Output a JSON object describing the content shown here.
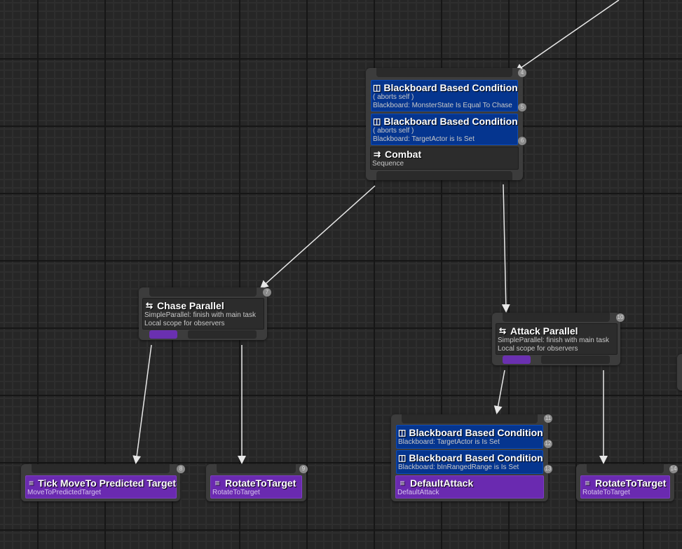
{
  "nodes": {
    "combat": {
      "badge": "4",
      "decorators": [
        {
          "title": "Blackboard Based Condition",
          "abort": "( aborts self )",
          "detail": "Blackboard: MonsterState Is Equal To Chase",
          "badge": "5"
        },
        {
          "title": "Blackboard Based Condition",
          "abort": "( aborts self )",
          "detail": "Blackboard: TargetActor is Is Set",
          "badge": "6"
        }
      ],
      "title": "Combat",
      "subtitle": "Sequence"
    },
    "chase": {
      "badge": "7",
      "title": "Chase Parallel",
      "line1": "SimpleParallel: finish with main task",
      "line2": "Local scope for observers"
    },
    "attack_parallel": {
      "badge": "10",
      "title": "Attack Parallel",
      "line1": "SimpleParallel: finish with main task",
      "line2": "Local scope for observers"
    },
    "attack": {
      "badge": "11",
      "decorators": [
        {
          "title": "Blackboard Based Condition",
          "detail": "Blackboard: TargetActor is Is Set",
          "badge": "12"
        },
        {
          "title": "Blackboard Based Condition",
          "detail": "Blackboard: bInRangedRange is Is Set",
          "badge": "13"
        }
      ],
      "title": "DefaultAttack",
      "subtitle": "DefaultAttack"
    },
    "tick_move": {
      "badge": "8",
      "title": "Tick MoveTo Predicted Target",
      "subtitle": "MoveToPredictedTarget"
    },
    "rotate1": {
      "badge": "9",
      "title": "RotateToTarget",
      "subtitle": "RotateToTarget"
    },
    "rotate2": {
      "badge": "14",
      "title": "RotateToTarget",
      "subtitle": "RotateToTarget"
    }
  },
  "icons": {
    "decorator": "blackboard-icon",
    "sequence": "sequence-icon",
    "parallel": "parallel-icon",
    "task": "task-icon"
  },
  "colors": {
    "decorator": "#05358f",
    "task": "#6a2ab0",
    "composite": "#2c2c2c",
    "parallel_main": "#6a30b0"
  }
}
